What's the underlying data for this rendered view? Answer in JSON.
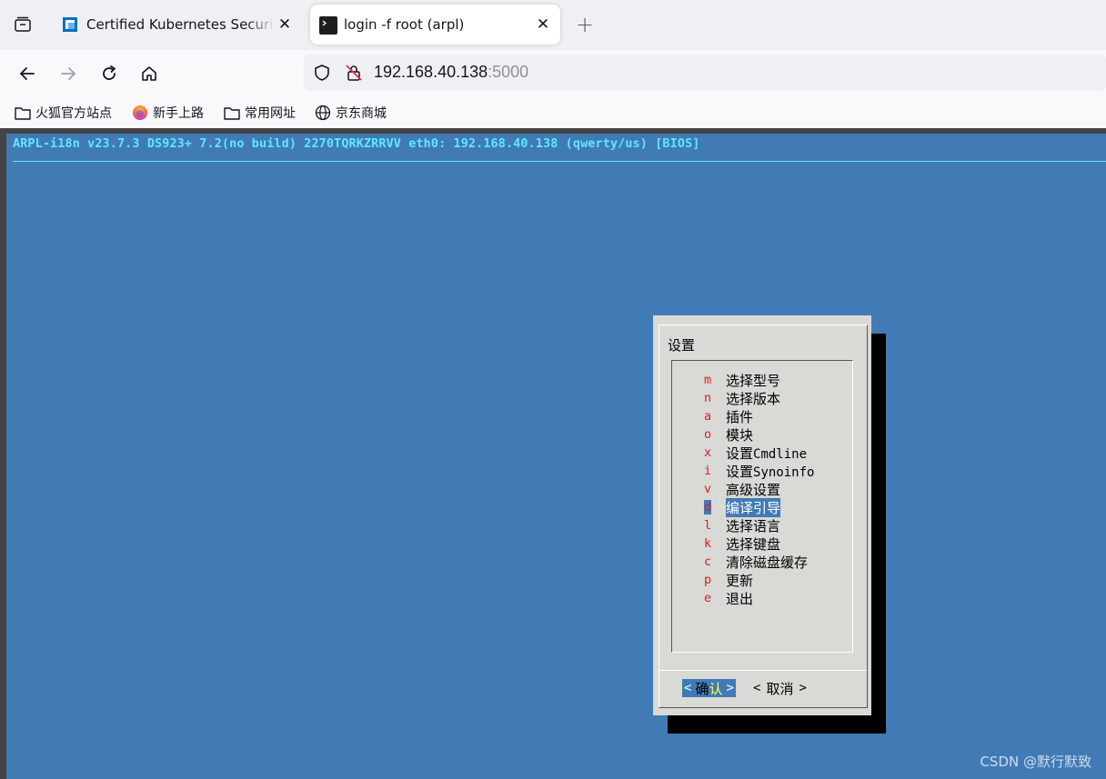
{
  "browser": {
    "tabs": [
      {
        "title": "Certified Kubernetes Security",
        "active": false,
        "favicon": "linux-foundation-icon"
      },
      {
        "title": "login -f root (arpl)",
        "active": true,
        "favicon": "terminal-icon"
      }
    ],
    "url": {
      "host": "192.168.40.138",
      "port": ":5000"
    },
    "bookmarks": [
      {
        "label": "火狐官方站点",
        "icon": "folder-icon"
      },
      {
        "label": "新手上路",
        "icon": "firefox-icon"
      },
      {
        "label": "常用网址",
        "icon": "folder-icon"
      },
      {
        "label": "京东商城",
        "icon": "globe-icon"
      }
    ]
  },
  "terminal": {
    "header": "ARPL-i18n v23.7.3 DS923+ 7.2(no build) 2270TQRKZRRVV eth0: 192.168.40.138 (qwerty/us) [BIOS]",
    "dialog": {
      "title": "设置",
      "items": [
        {
          "key": "m",
          "label": "选择型号"
        },
        {
          "key": "n",
          "label": "选择版本"
        },
        {
          "key": "a",
          "label": "插件"
        },
        {
          "key": "o",
          "label": "模块"
        },
        {
          "key": "x",
          "label_prefix": "设置",
          "label_suffix": "Cmdline"
        },
        {
          "key": "i",
          "label_prefix": "设置",
          "label_suffix": "Synoinfo"
        },
        {
          "key": "v",
          "label": "高级设置"
        },
        {
          "key": "d",
          "label": "编译引导",
          "selected": true
        },
        {
          "key": "l",
          "label": "选择语言"
        },
        {
          "key": "k",
          "label": "选择键盘"
        },
        {
          "key": "c",
          "label": "清除磁盘缓存"
        },
        {
          "key": "p",
          "label": "更新"
        },
        {
          "key": "e",
          "label": "退出"
        }
      ],
      "ok_button": {
        "left": "<",
        "c1": "确",
        "c2": "认",
        "right": ">"
      },
      "cancel_button": {
        "left": "<",
        "label": "取消",
        "right": ">"
      }
    },
    "colors": {
      "background": "#417bb6",
      "header": "#5ee8ff",
      "hotkey": "#e02020"
    }
  },
  "watermark": "CSDN @默行默致"
}
